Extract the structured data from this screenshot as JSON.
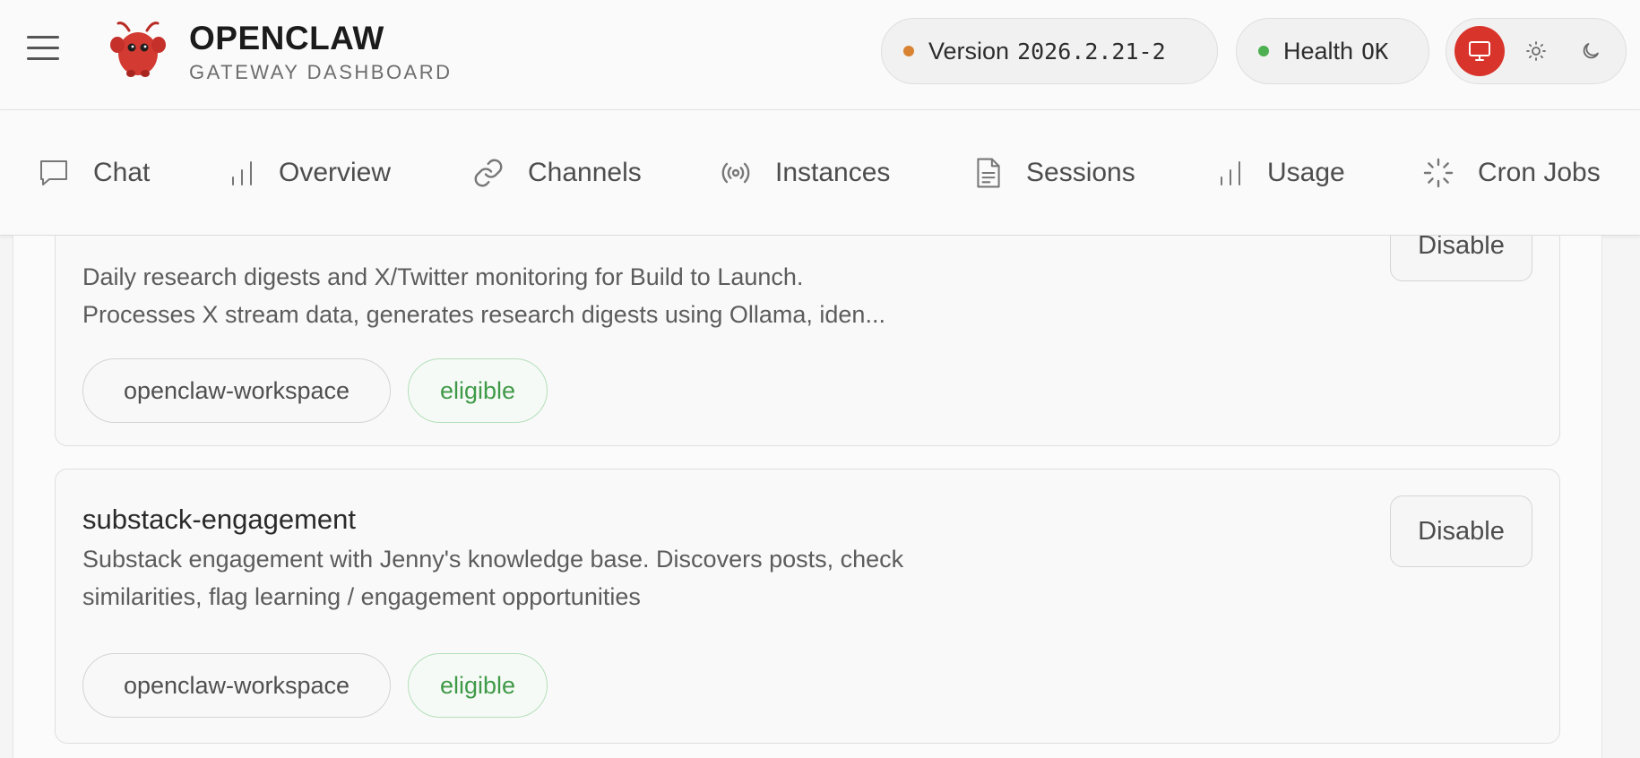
{
  "header": {
    "brand_title": "OPENCLAW",
    "brand_subtitle": "GATEWAY DASHBOARD",
    "version_label": "Version",
    "version_value": "2026.2.21-2",
    "version_dot_color": "#d98332",
    "health_label": "Health",
    "health_value": "OK",
    "health_dot_color": "#4caf50",
    "theme_options": [
      "monitor-icon",
      "sun-icon",
      "moon-icon"
    ],
    "theme_active": "monitor-icon",
    "accent_color": "#d9342b"
  },
  "nav": {
    "items": [
      {
        "label": "Chat",
        "icon": "chat-bubble-icon"
      },
      {
        "label": "Overview",
        "icon": "bar-chart-icon"
      },
      {
        "label": "Channels",
        "icon": "link-icon"
      },
      {
        "label": "Instances",
        "icon": "broadcast-icon"
      },
      {
        "label": "Sessions",
        "icon": "document-icon"
      },
      {
        "label": "Usage",
        "icon": "bar-chart-icon"
      },
      {
        "label": "Cron Jobs",
        "icon": "loader-icon"
      }
    ]
  },
  "skills": [
    {
      "name": "",
      "description_lines": [
        "Daily research digests and X/Twitter monitoring for Build to Launch.",
        "Processes X stream data, generates research digests using Ollama, iden..."
      ],
      "action_label": "Disable",
      "tags": [
        "openclaw-workspace",
        "eligible"
      ]
    },
    {
      "name": "substack-engagement",
      "description_lines": [
        "Substack engagement with Jenny's knowledge base. Discovers posts, check",
        "similarities, flag learning / engagement opportunities"
      ],
      "action_label": "Disable",
      "tags": [
        "openclaw-workspace",
        "eligible"
      ]
    }
  ]
}
